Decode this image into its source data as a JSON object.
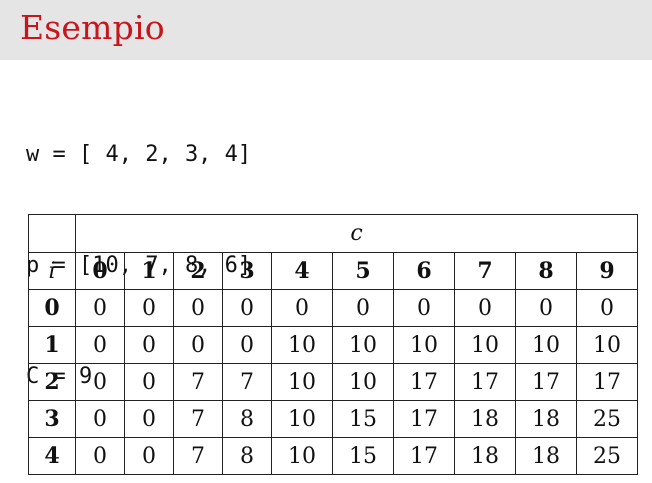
{
  "slide": {
    "title": "Esempio"
  },
  "code": {
    "lines": [
      "w = [ 4, 2, 3, 4]",
      "p = [10, 7, 8, 6]",
      "C = 9"
    ]
  },
  "table": {
    "capacity_label": "c",
    "item_label": "i",
    "capacities": [
      "0",
      "1",
      "2",
      "3",
      "4",
      "5",
      "6",
      "7",
      "8",
      "9"
    ],
    "rows": [
      {
        "i": "0",
        "values": [
          "0",
          "0",
          "0",
          "0",
          "0",
          "0",
          "0",
          "0",
          "0",
          "0"
        ]
      },
      {
        "i": "1",
        "values": [
          "0",
          "0",
          "0",
          "0",
          "10",
          "10",
          "10",
          "10",
          "10",
          "10"
        ]
      },
      {
        "i": "2",
        "values": [
          "0",
          "0",
          "7",
          "7",
          "10",
          "10",
          "17",
          "17",
          "17",
          "17"
        ]
      },
      {
        "i": "3",
        "values": [
          "0",
          "0",
          "7",
          "8",
          "10",
          "15",
          "17",
          "18",
          "18",
          "25"
        ]
      },
      {
        "i": "4",
        "values": [
          "0",
          "0",
          "7",
          "8",
          "10",
          "15",
          "17",
          "18",
          "18",
          "25"
        ]
      }
    ]
  }
}
